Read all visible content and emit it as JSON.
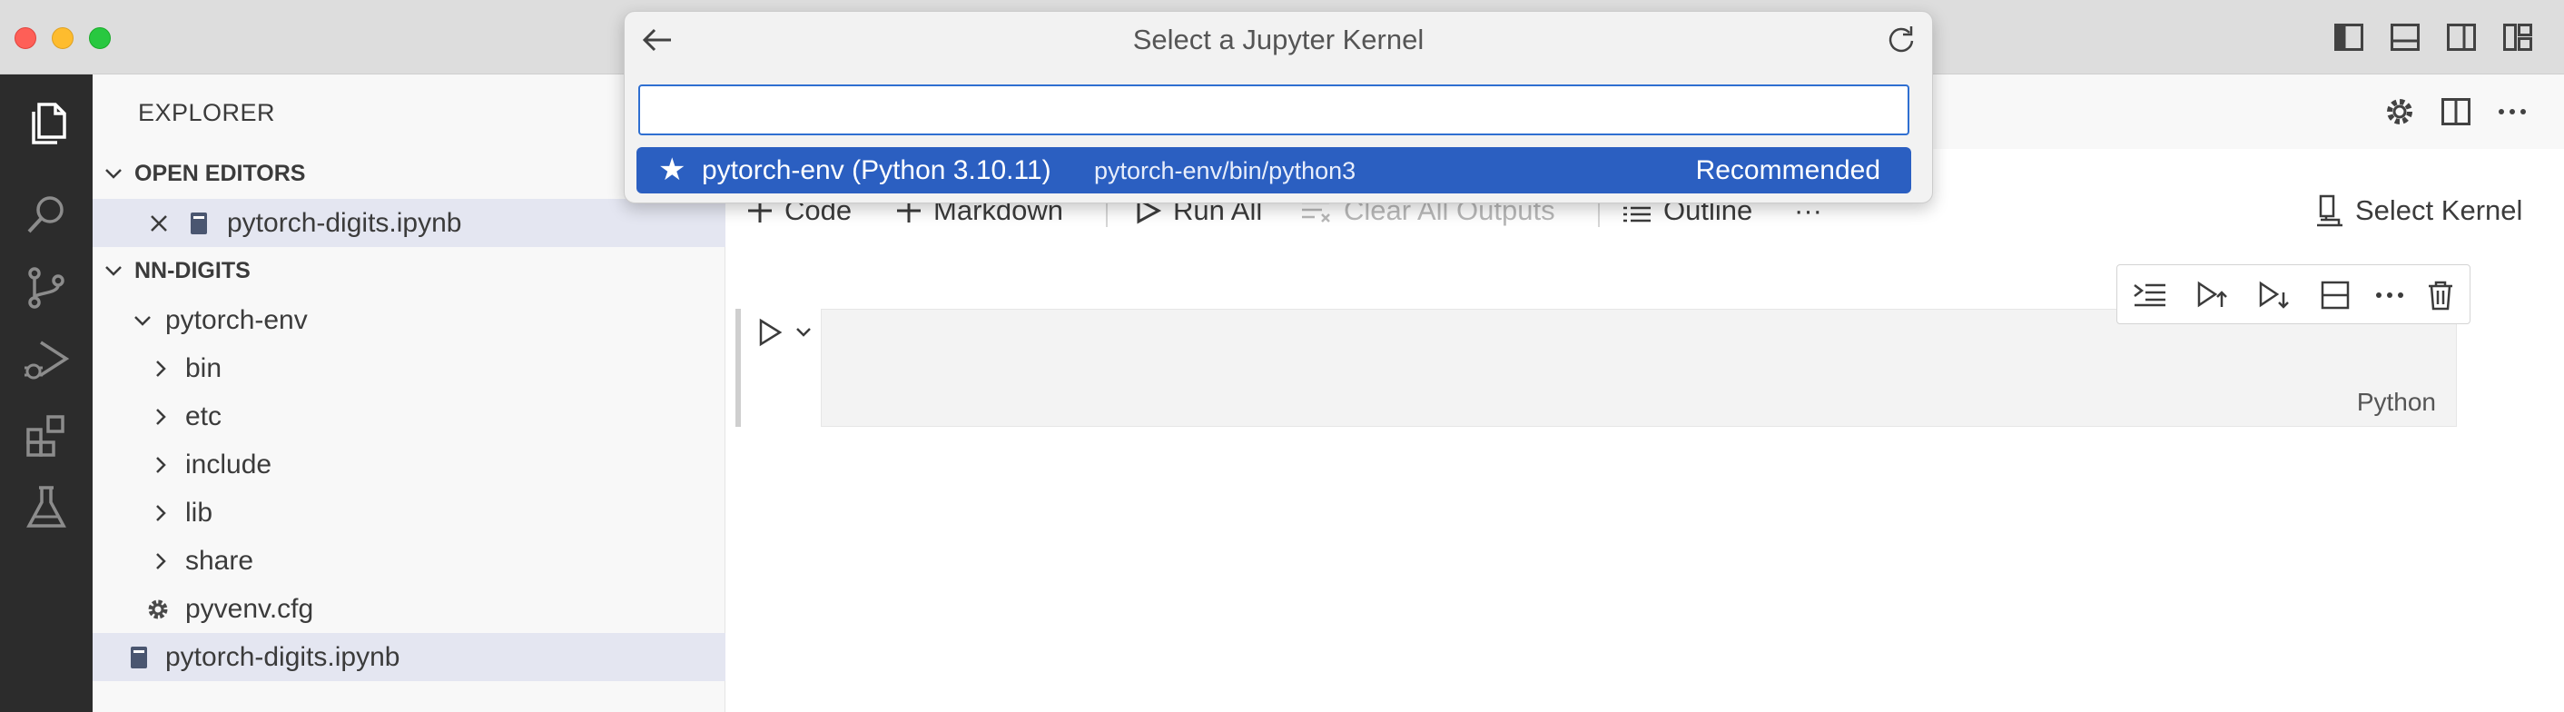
{
  "quickpick": {
    "title": "Select a Jupyter Kernel",
    "input_value": "",
    "items": [
      {
        "label": "pytorch-env (Python 3.10.11)",
        "description": "pytorch-env/bin/python3",
        "detail": "Recommended",
        "icon": "star-icon"
      }
    ]
  },
  "sidebar": {
    "title": "EXPLORER",
    "open_editors": {
      "header": "OPEN EDITORS",
      "items": [
        {
          "name": "pytorch-digits.ipynb"
        }
      ]
    },
    "workspace": {
      "header": "NN-DIGITS",
      "tree": [
        {
          "name": "pytorch-env",
          "type": "folder",
          "expanded": true
        },
        {
          "name": "bin",
          "type": "folder"
        },
        {
          "name": "etc",
          "type": "folder"
        },
        {
          "name": "include",
          "type": "folder"
        },
        {
          "name": "lib",
          "type": "folder"
        },
        {
          "name": "share",
          "type": "folder"
        },
        {
          "name": "pyvenv.cfg",
          "type": "file"
        },
        {
          "name": "pytorch-digits.ipynb",
          "type": "notebook"
        }
      ]
    }
  },
  "notebook": {
    "toolbar": {
      "code": "Code",
      "markdown": "Markdown",
      "run_all": "Run All",
      "clear_outputs": "Clear All Outputs",
      "outline": "Outline",
      "more": "···",
      "select_kernel": "Select Kernel"
    },
    "cell": {
      "language": "Python"
    },
    "cell_toolbar_more": "···"
  },
  "activity_bar": [
    "files-icon",
    "search-icon",
    "source-control-icon",
    "run-debug-icon",
    "extensions-icon",
    "testing-icon"
  ],
  "colors": {
    "accent": "#2b5fc1",
    "input_border": "#2f6fd1",
    "activity_bg": "#2c2c2c",
    "sidebar_selected": "#e4e6f1"
  }
}
